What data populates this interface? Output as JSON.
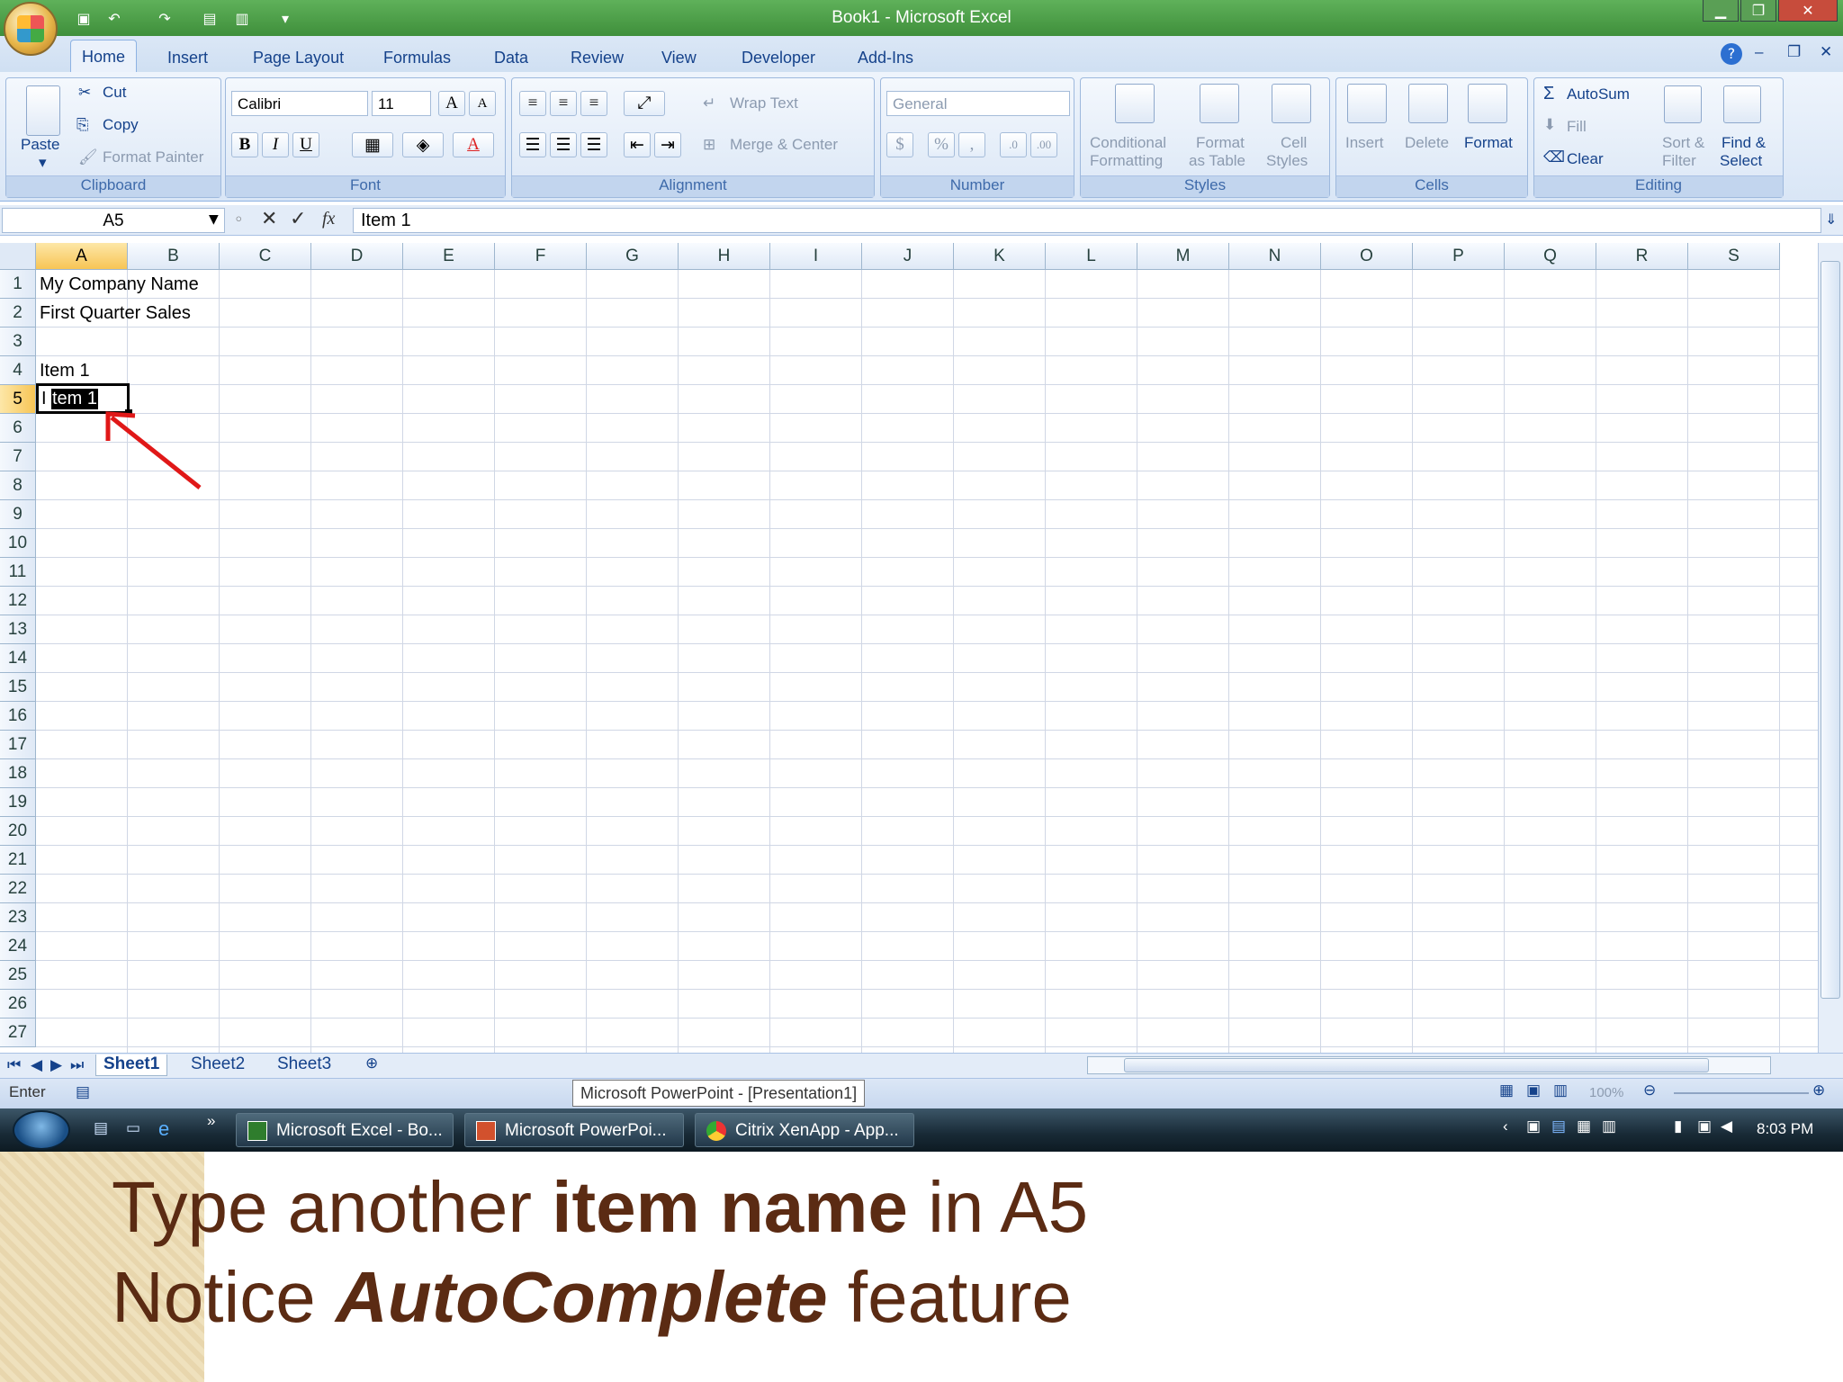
{
  "window": {
    "title": "Book1 - Microsoft Excel"
  },
  "ribbon_tabs": [
    "Home",
    "Insert",
    "Page Layout",
    "Formulas",
    "Data",
    "Review",
    "View",
    "Developer",
    "Add-Ins"
  ],
  "clipboard": {
    "label": "Clipboard",
    "paste": "Paste",
    "cut": "Cut",
    "copy": "Copy",
    "format_painter": "Format Painter"
  },
  "font": {
    "label": "Font",
    "name": "Calibri",
    "size": "11",
    "bold": "B",
    "italic": "I",
    "underline": "U",
    "grow": "A",
    "shrink": "A",
    "color": "A"
  },
  "alignment": {
    "label": "Alignment",
    "wrap_text": "Wrap Text",
    "merge_center": "Merge & Center"
  },
  "number": {
    "label": "Number",
    "format": "General",
    "currency": "$",
    "percent": "%",
    "comma": ","
  },
  "styles": {
    "label": "Styles",
    "conditional_1": "Conditional",
    "conditional_2": "Formatting",
    "format_table_1": "Format",
    "format_table_2": "as Table",
    "cell_styles_1": "Cell",
    "cell_styles_2": "Styles"
  },
  "cells": {
    "label": "Cells",
    "insert": "Insert",
    "delete": "Delete",
    "format": "Format"
  },
  "editing": {
    "label": "Editing",
    "autosum": "AutoSum",
    "fill": "Fill",
    "clear": "Clear",
    "sort_1": "Sort &",
    "sort_2": "Filter",
    "find_1": "Find &",
    "find_2": "Select"
  },
  "formula_bar": {
    "name_box": "A5",
    "fx": "fx",
    "value": "Item 1"
  },
  "columns": [
    "A",
    "B",
    "C",
    "D",
    "E",
    "F",
    "G",
    "H",
    "I",
    "J",
    "K",
    "L",
    "M",
    "N",
    "O",
    "P",
    "Q",
    "R",
    "S"
  ],
  "rows": [
    "1",
    "2",
    "3",
    "4",
    "5",
    "6",
    "7",
    "8",
    "9",
    "10",
    "11",
    "12",
    "13",
    "14",
    "15",
    "16",
    "17",
    "18",
    "19",
    "20",
    "21",
    "22",
    "23",
    "24",
    "25",
    "26",
    "27"
  ],
  "cells_data": {
    "A1": "My Company Name",
    "A2": "First Quarter Sales",
    "A4": "Item 1",
    "A5_typed": "I",
    "A5_autocomplete": "tem 1"
  },
  "sheet_tabs": [
    "Sheet1",
    "Sheet2",
    "Sheet3"
  ],
  "status": {
    "mode": "Enter",
    "zoom": "100%",
    "tooltip": "Microsoft PowerPoint - [Presentation1]"
  },
  "taskbar": {
    "tasks": [
      "Microsoft Excel - Bo...",
      "Microsoft PowerPoi...",
      "Citrix XenApp - App..."
    ],
    "clock": "8:03 PM",
    "chevrons": "»"
  },
  "caption": {
    "line1_pre": "Type another ",
    "line1_bold": "item name",
    "line1_post": " in A5",
    "line2_pre": "Notice ",
    "line2_bolditalic": "AutoComplete",
    "line2_post": " feature"
  },
  "colors": {
    "title_green": "#4b9e46",
    "ribbon_blue": "#dbe7f6",
    "annotation_red": "#e01818",
    "caption_brown": "#5b2b13"
  }
}
